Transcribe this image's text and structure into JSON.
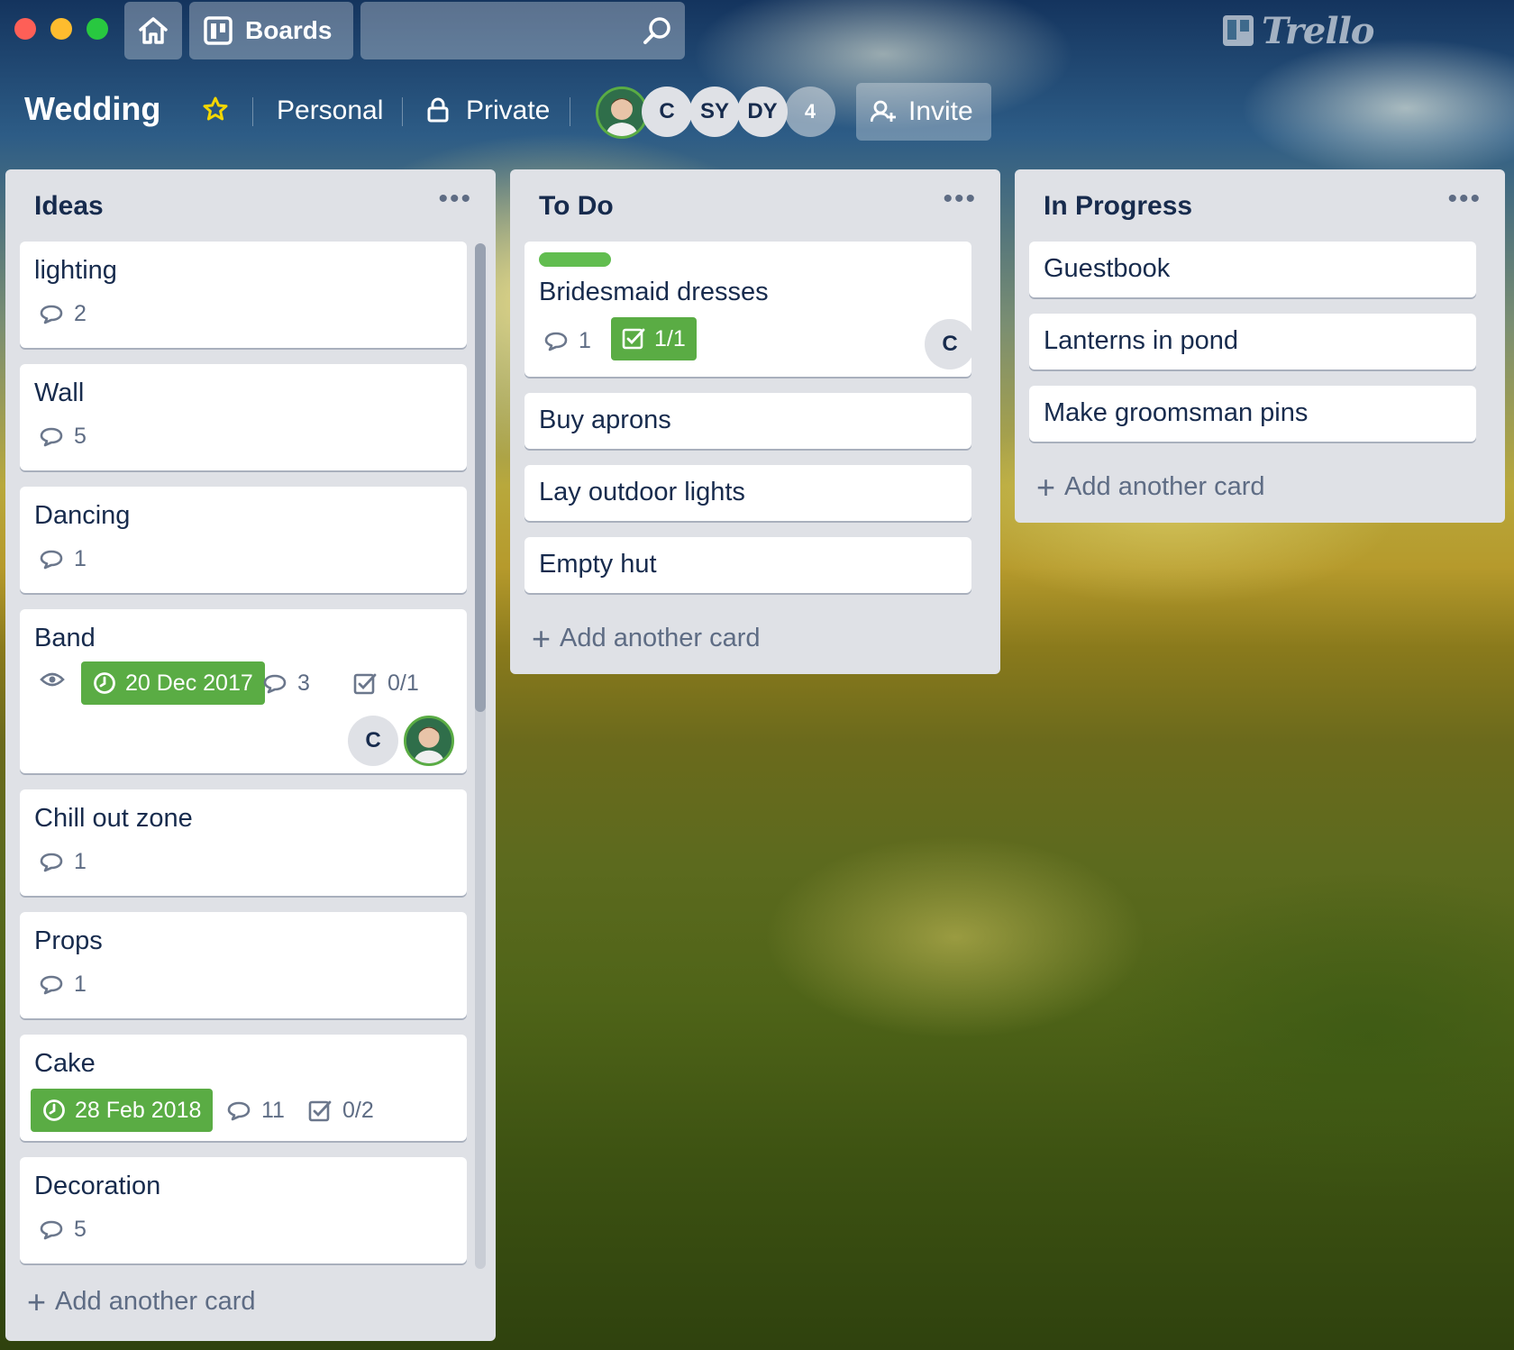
{
  "app": {
    "logo_text": "Trello"
  },
  "topbar": {
    "boards_label": "Boards",
    "search_value": ""
  },
  "board": {
    "title": "Wedding",
    "team": "Personal",
    "visibility": "Private",
    "members": [
      "C",
      "SY",
      "DY"
    ],
    "member_overflow": "4",
    "invite_label": "Invite"
  },
  "lists": [
    {
      "title": "Ideas",
      "add_label": "Add another card",
      "cards": [
        {
          "title": "lighting",
          "comments": "2"
        },
        {
          "title": "Wall",
          "comments": "5"
        },
        {
          "title": "Dancing",
          "comments": "1"
        },
        {
          "title": "Band",
          "due": "20 Dec 2017",
          "comments": "3",
          "checklist": "0/1",
          "members": [
            "C"
          ]
        },
        {
          "title": "Chill out zone",
          "comments": "1"
        },
        {
          "title": "Props",
          "comments": "1"
        },
        {
          "title": "Cake",
          "due": "28 Feb 2018",
          "comments": "11",
          "checklist": "0/2"
        },
        {
          "title": "Decoration",
          "comments": "5"
        }
      ]
    },
    {
      "title": "To Do",
      "add_label": "Add another card",
      "cards": [
        {
          "title": "Bridesmaid dresses",
          "label_color": "#61bd4f",
          "comments": "1",
          "checklist": "1/1",
          "members": [
            "C"
          ]
        },
        {
          "title": "Buy aprons"
        },
        {
          "title": "Lay outdoor lights"
        },
        {
          "title": "Empty hut"
        }
      ]
    },
    {
      "title": "In Progress",
      "add_label": "Add another card",
      "cards": [
        {
          "title": "Guestbook"
        },
        {
          "title": "Lanterns in pond"
        },
        {
          "title": "Make groomsman pins"
        }
      ]
    }
  ],
  "colors": {
    "due_green": "#5aac44",
    "list_bg": "#dfe1e6",
    "text": "#172b4d"
  },
  "icons": [
    "home-icon",
    "boards-icon",
    "search-icon",
    "star-icon",
    "lock-icon",
    "add-member-icon",
    "comment-icon",
    "watch-icon",
    "clock-icon",
    "checklist-icon",
    "more-icon",
    "plus-icon"
  ]
}
